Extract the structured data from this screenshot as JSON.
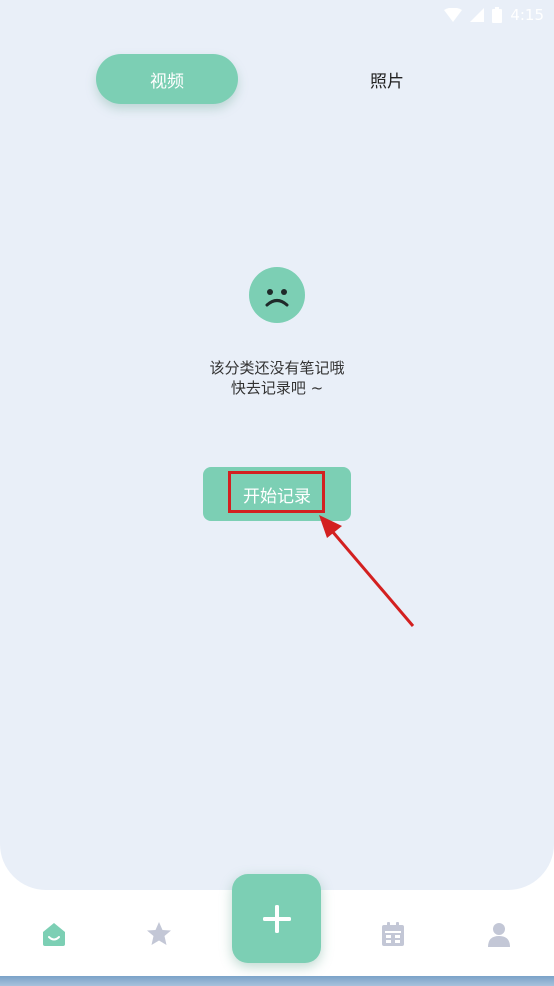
{
  "status_bar": {
    "time": "4:15"
  },
  "tabs": [
    {
      "label": "视频",
      "active": true
    },
    {
      "label": "照片",
      "active": false
    }
  ],
  "empty_state": {
    "icon": "sad-face-icon",
    "line1": "该分类还没有笔记哦",
    "line2": "快去记录吧 ~"
  },
  "start_button": {
    "label": "开始记录"
  },
  "bottom_nav": {
    "items": [
      {
        "name": "home",
        "icon": "home-icon",
        "active": true
      },
      {
        "name": "favorites",
        "icon": "star-icon",
        "active": false
      },
      {
        "name": "add",
        "icon": "plus-icon",
        "active": false
      },
      {
        "name": "calendar",
        "icon": "calendar-icon",
        "active": false
      },
      {
        "name": "profile",
        "icon": "person-icon",
        "active": false
      }
    ]
  },
  "colors": {
    "accent": "#7ccfb4",
    "background": "#e9eff8",
    "inactive_icon": "#c3c7d6",
    "highlight": "#d32020"
  }
}
